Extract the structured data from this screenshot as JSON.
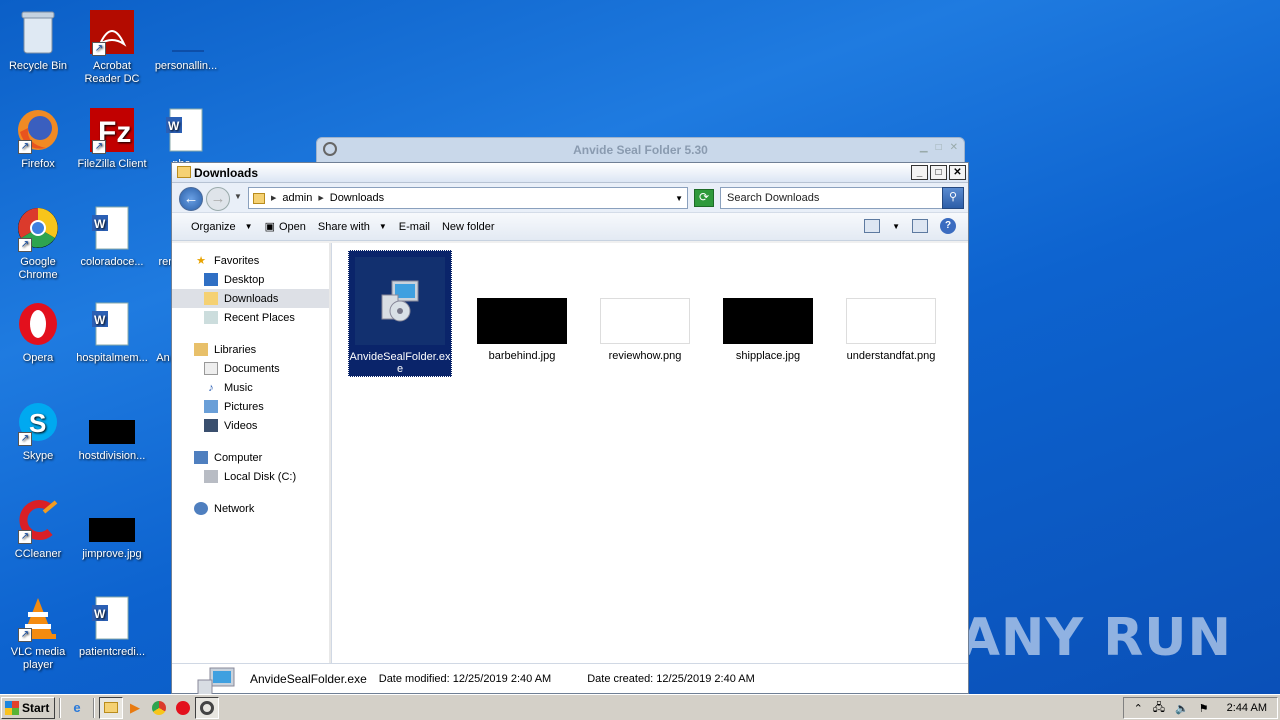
{
  "desktop": {
    "icons": [
      {
        "label": "Recycle Bin",
        "icon": "recycle-bin-icon"
      },
      {
        "label": "Acrobat Reader DC",
        "icon": "acrobat-icon"
      },
      {
        "label": "personallin...",
        "icon": "doc-icon"
      },
      {
        "label": "Firefox",
        "icon": "firefox-icon"
      },
      {
        "label": "FileZilla Client",
        "icon": "filezilla-icon"
      },
      {
        "label": "pho...",
        "icon": "word-doc-icon"
      },
      {
        "label": "Google Chrome",
        "icon": "chrome-icon"
      },
      {
        "label": "coloradoce...",
        "icon": "word-doc-icon"
      },
      {
        "label": "rem",
        "icon": "doc-icon"
      },
      {
        "label": "Opera",
        "icon": "opera-icon"
      },
      {
        "label": "hospitalmem...",
        "icon": "word-doc-icon"
      },
      {
        "label": "An",
        "icon": "doc-icon"
      },
      {
        "label": "Skype",
        "icon": "skype-icon"
      },
      {
        "label": "hostdivision...",
        "icon": "image-file-icon"
      },
      {
        "label": "CCleaner",
        "icon": "ccleaner-icon"
      },
      {
        "label": "jimprove.jpg",
        "icon": "image-file-icon"
      },
      {
        "label": "VLC media player",
        "icon": "vlc-icon"
      },
      {
        "label": "patientcredi...",
        "icon": "word-doc-icon"
      }
    ],
    "watermark": "ANY RUN"
  },
  "bg_window": {
    "title": "Anvide Seal Folder 5.30"
  },
  "explorer": {
    "title": "Downloads",
    "breadcrumb": [
      "admin",
      "Downloads"
    ],
    "search_placeholder": "Search Downloads",
    "toolbar": {
      "organize": "Organize",
      "open": "Open",
      "share_with": "Share with",
      "email": "E-mail",
      "new_folder": "New folder"
    },
    "nav": {
      "favorites": "Favorites",
      "desktop": "Desktop",
      "downloads": "Downloads",
      "recent_places": "Recent Places",
      "libraries": "Libraries",
      "documents": "Documents",
      "music": "Music",
      "pictures": "Pictures",
      "videos": "Videos",
      "computer": "Computer",
      "local_disk": "Local Disk (C:)",
      "network": "Network"
    },
    "files": [
      {
        "name": "AnvideSealFolder.exe",
        "selected": true
      },
      {
        "name": "barbehind.jpg"
      },
      {
        "name": "reviewhow.png"
      },
      {
        "name": "shipplace.jpg"
      },
      {
        "name": "understandfat.png"
      }
    ],
    "status": {
      "filename": "AnvideSealFolder.exe",
      "modified": "Date modified:  12/25/2019 2:40 AM",
      "created": "Date created:  12/25/2019 2:40 AM"
    }
  },
  "taskbar": {
    "start": "Start",
    "time": "2:44 AM"
  }
}
